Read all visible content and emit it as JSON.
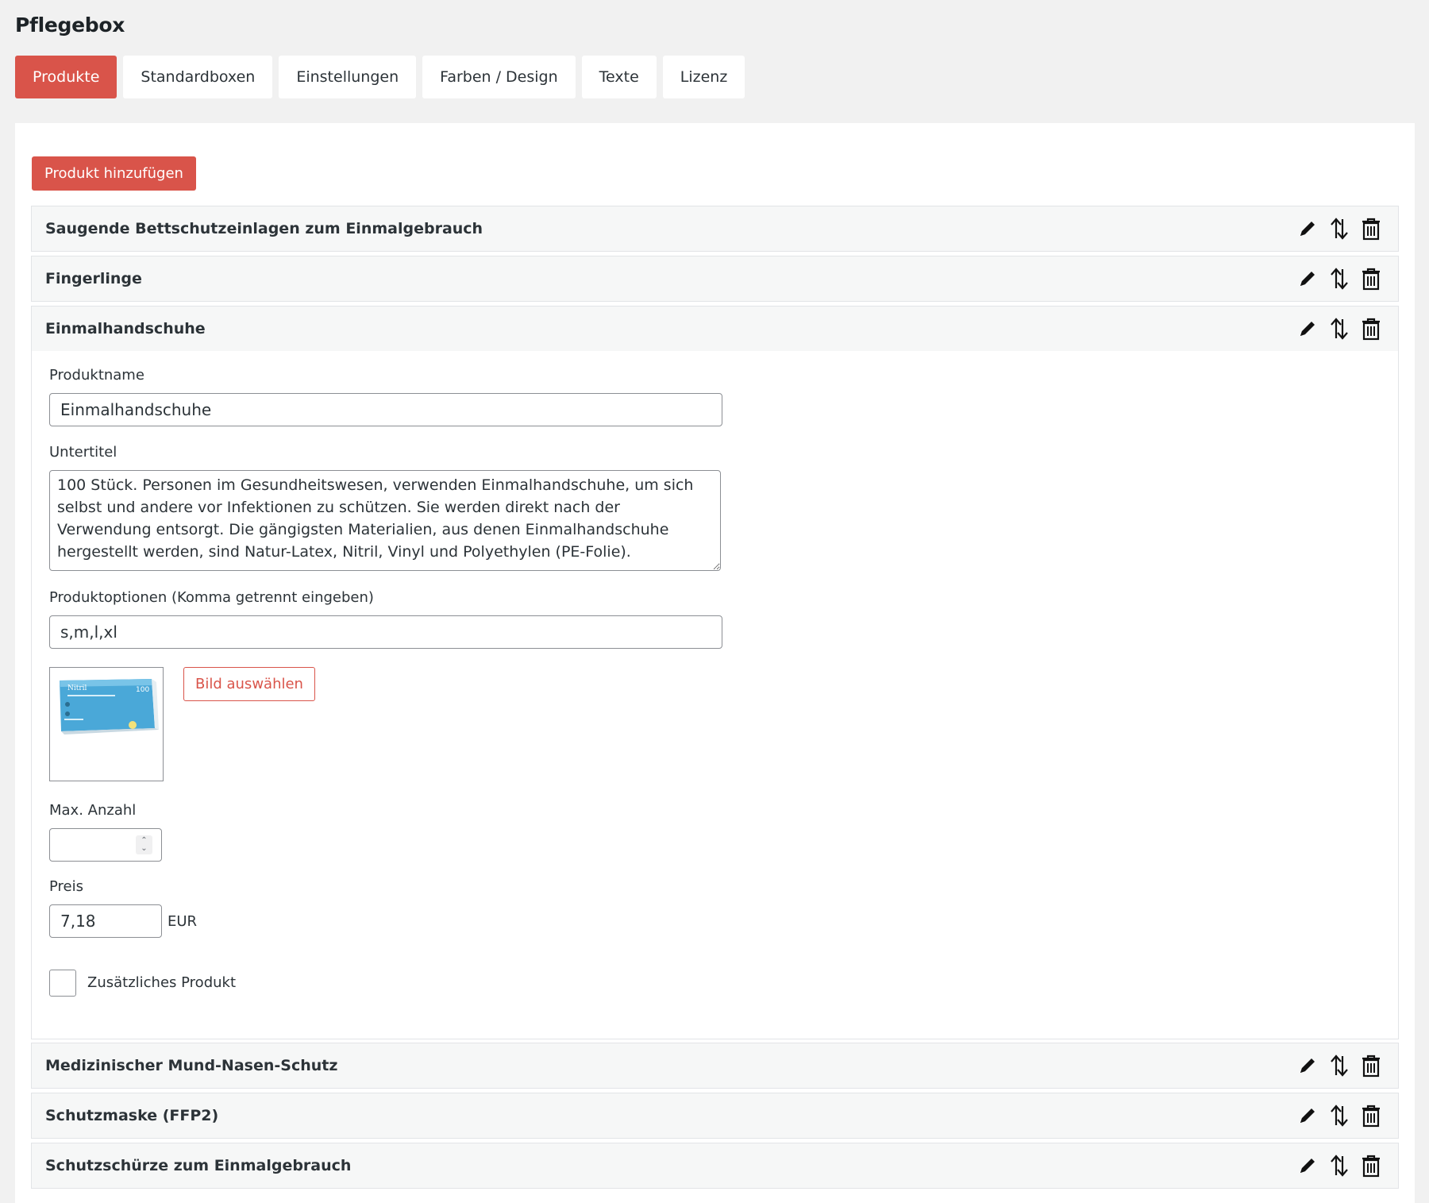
{
  "page": {
    "title": "Pflegebox"
  },
  "tabs": [
    {
      "label": "Produkte",
      "active": true
    },
    {
      "label": "Standardboxen"
    },
    {
      "label": "Einstellungen"
    },
    {
      "label": "Farben / Design"
    },
    {
      "label": "Texte"
    },
    {
      "label": "Lizenz"
    }
  ],
  "add_button": "Produkt hinzufügen",
  "products": [
    {
      "title": "Saugende Bettschutzeinlagen zum Einmalgebrauch"
    },
    {
      "title": "Fingerlinge"
    },
    {
      "title": "Einmalhandschuhe",
      "expanded": true
    },
    {
      "title": "Medizinischer Mund-Nasen-Schutz"
    },
    {
      "title": "Schutzmaske (FFP2)"
    },
    {
      "title": "Schutzschürze zum Einmalgebrauch"
    }
  ],
  "form": {
    "name_label": "Produktname",
    "name_value": "Einmalhandschuhe",
    "subtitle_label": "Untertitel",
    "subtitle_value": "100 Stück. Personen im Gesundheitswesen, verwenden Einmalhandschuhe, um sich selbst und andere vor Infektionen zu schützen. Sie werden direkt nach der Verwendung entsorgt. Die gängigsten Materialien, aus denen Einmalhandschuhe hergestellt werden, sind Natur-Latex, Nitril, Vinyl und Polyethylen (PE-Folie).",
    "options_label": "Produktoptionen (Komma getrennt eingeben)",
    "options_value": "s,m,l,xl",
    "image_button": "Bild auswählen",
    "image_box_text": "Nitril",
    "image_box_count": "100",
    "max_label": "Max. Anzahl",
    "max_value": "",
    "price_label": "Preis",
    "price_value": "7,18",
    "currency": "EUR",
    "extra_label": "Zusätzliches Produkt",
    "extra_checked": false
  },
  "icons": [
    "pencil-icon",
    "sort-arrows-icon",
    "trash-icon"
  ],
  "colors": {
    "accent": "#d9544a",
    "background": "#f1f1f1",
    "header": "#f6f7f7"
  }
}
